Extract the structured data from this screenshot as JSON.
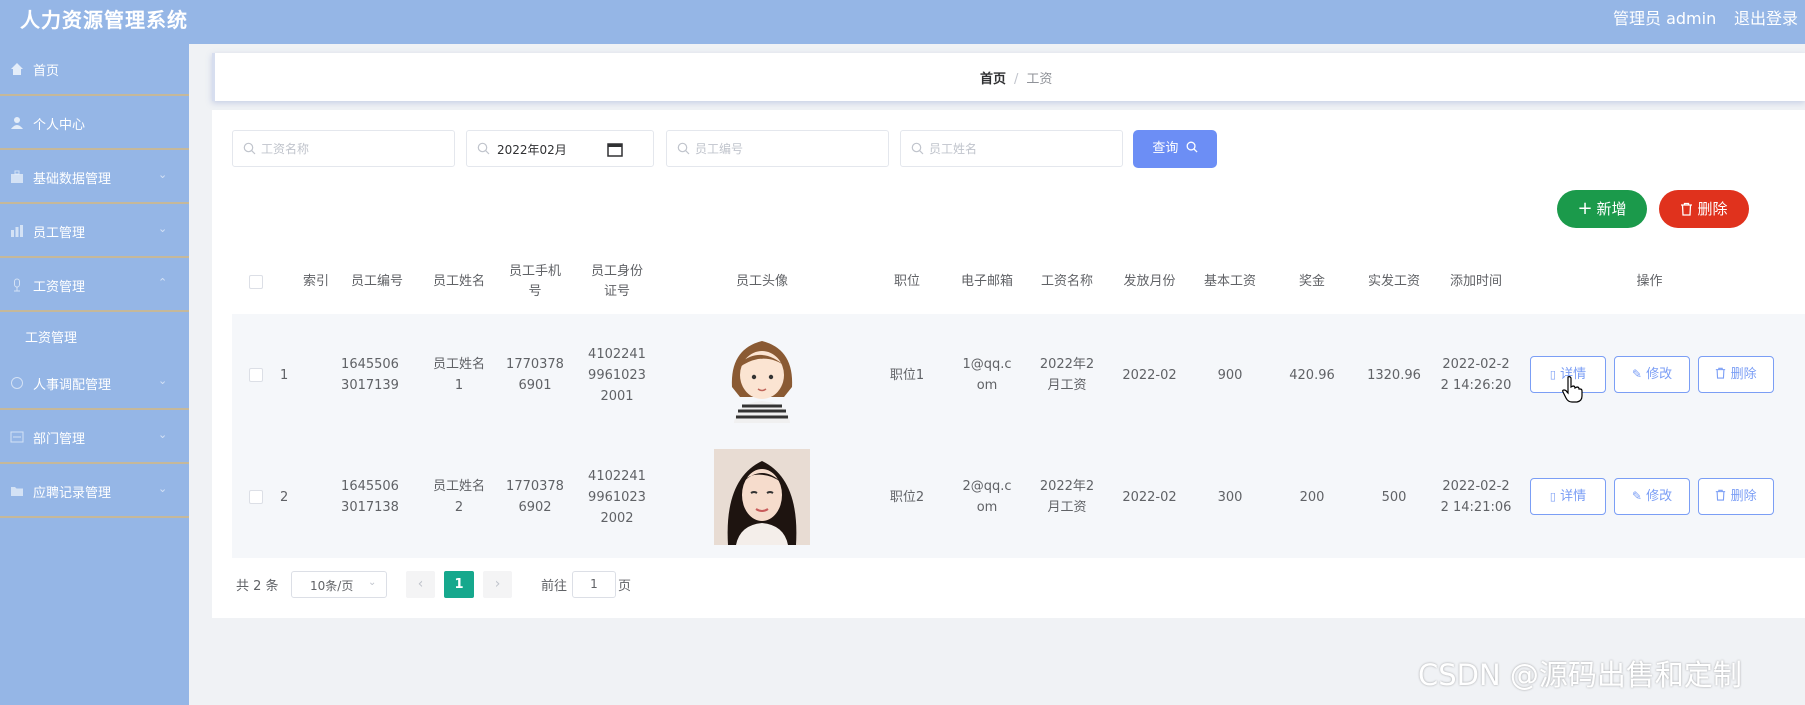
{
  "header": {
    "app_title": "人力资源管理系统",
    "admin_label": "管理员 admin",
    "logout_label": "退出登录"
  },
  "sidebar": {
    "items": [
      {
        "label": "首页",
        "icon": "home-icon"
      },
      {
        "label": "个人中心",
        "icon": "user-icon"
      },
      {
        "label": "基础数据管理",
        "icon": "briefcase-icon"
      },
      {
        "label": "员工管理",
        "icon": "chart-icon"
      },
      {
        "label": "工资管理",
        "icon": "mic-icon"
      },
      {
        "label": "人事调配管理",
        "icon": "circle-icon"
      },
      {
        "label": "部门管理",
        "icon": "card-icon"
      },
      {
        "label": "应聘记录管理",
        "icon": "folder-icon"
      }
    ],
    "sub_item": "工资管理"
  },
  "breadcrumb": {
    "home": "首页",
    "separator": "/",
    "current": "工资"
  },
  "search": {
    "salary_name_placeholder": "工资名称",
    "month_value": "2022年02月",
    "employee_no_placeholder": "员工编号",
    "employee_name_placeholder": "员工姓名",
    "query_label": "查询"
  },
  "actions": {
    "add_label": "新增",
    "delete_label": "删除"
  },
  "table": {
    "headers": [
      "索引",
      "员工编号",
      "员工姓名",
      "员工手机号",
      "员工身份证号",
      "员工头像",
      "职位",
      "电子邮箱",
      "工资名称",
      "发放月份",
      "基本工资",
      "奖金",
      "实发工资",
      "添加时间",
      "操作"
    ],
    "rows": [
      {
        "index": "1",
        "employee_no": "16455063017139",
        "employee_name": "员工姓名1",
        "phone": "17703786901",
        "id_card": "410224199610232001",
        "avatar": "cartoon-girl-avatar",
        "position": "职位1",
        "email": "1@qq.com",
        "salary_name": "2022年2月工资",
        "month": "2022-02",
        "base_salary": "900",
        "bonus": "420.96",
        "net_salary": "1320.96",
        "added_time": "2022-02-22 14:26:20"
      },
      {
        "index": "2",
        "employee_no": "16455063017138",
        "employee_name": "员工姓名2",
        "phone": "17703786902",
        "id_card": "410224199610232002",
        "avatar": "photo-woman-avatar",
        "position": "职位2",
        "email": "2@qq.com",
        "salary_name": "2022年2月工资",
        "month": "2022-02",
        "base_salary": "300",
        "bonus": "200",
        "net_salary": "500",
        "added_time": "2022-02-22 14:21:06"
      }
    ],
    "row_actions": {
      "detail": "详情",
      "edit": "修改",
      "delete": "删除"
    }
  },
  "pagination": {
    "total": "共 2 条",
    "page_size": "10条/页",
    "current_page": "1",
    "goto_label": "前往",
    "goto_value": "1",
    "page_unit": "页"
  },
  "watermark": "CSDN @源码出售和定制",
  "colors": {
    "sidebar_bg": "#95b6e6",
    "primary": "#6c8ef5",
    "success": "#1b9a4b",
    "danger": "#e0321d",
    "page_active": "#16a88d"
  }
}
